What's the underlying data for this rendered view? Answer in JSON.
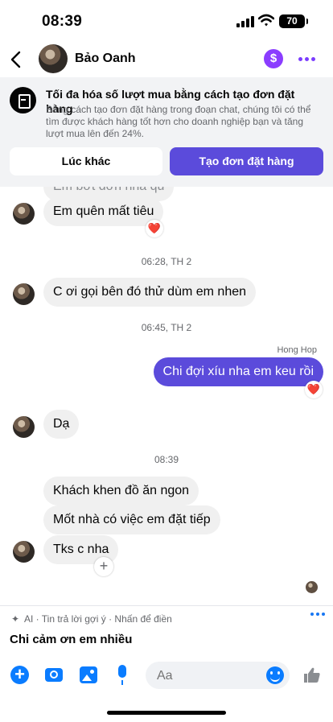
{
  "status_bar": {
    "time": "08:39",
    "battery": "70"
  },
  "header": {
    "contact_name": "Bảo Oanh",
    "payment_symbol": "$"
  },
  "banner": {
    "title": "Tối đa hóa số lượt mua bằng cách tạo đơn đặt hàng",
    "body": "Bằng cách tạo đơn đặt hàng trong đoạn chat, chúng tôi có thể tìm được khách hàng tốt hơn cho doanh nghiệp bạn và tăng lượt mua lên đến 24%.",
    "later_label": "Lúc khác",
    "order_label": "Tạo đơn đặt hàng"
  },
  "chat": {
    "cut_message": "Em bớt đơn nha qu",
    "messages": [
      {
        "text": "Em quên mất tiêu",
        "reaction": "❤️"
      },
      {
        "timestamp": "06:28, TH 2"
      },
      {
        "text": "C ơi gọi bên đó thử dùm em nhen"
      },
      {
        "timestamp": "06:45, TH 2"
      },
      {
        "sender": "Hong Hop",
        "text": "Chi đợi xíu nha em keu rồi",
        "reaction": "❤️"
      },
      {
        "text": "Dạ"
      },
      {
        "timestamp": "08:39"
      },
      {
        "text": "Khách khen đồ ăn ngon"
      },
      {
        "text": "Mốt nhà có việc em đặt tiếp"
      },
      {
        "text": "Tks c nha"
      }
    ]
  },
  "suggestion": {
    "hint": "AI · Tin trả lời gợi ý · Nhấn để điền",
    "text": "Chi cảm ơn em nhiều"
  },
  "composer": {
    "placeholder": "Aa"
  },
  "colors": {
    "accent": "#5b4bdb",
    "messenger_blue": "#0a7cff",
    "payment_purple": "#8b3dff"
  }
}
